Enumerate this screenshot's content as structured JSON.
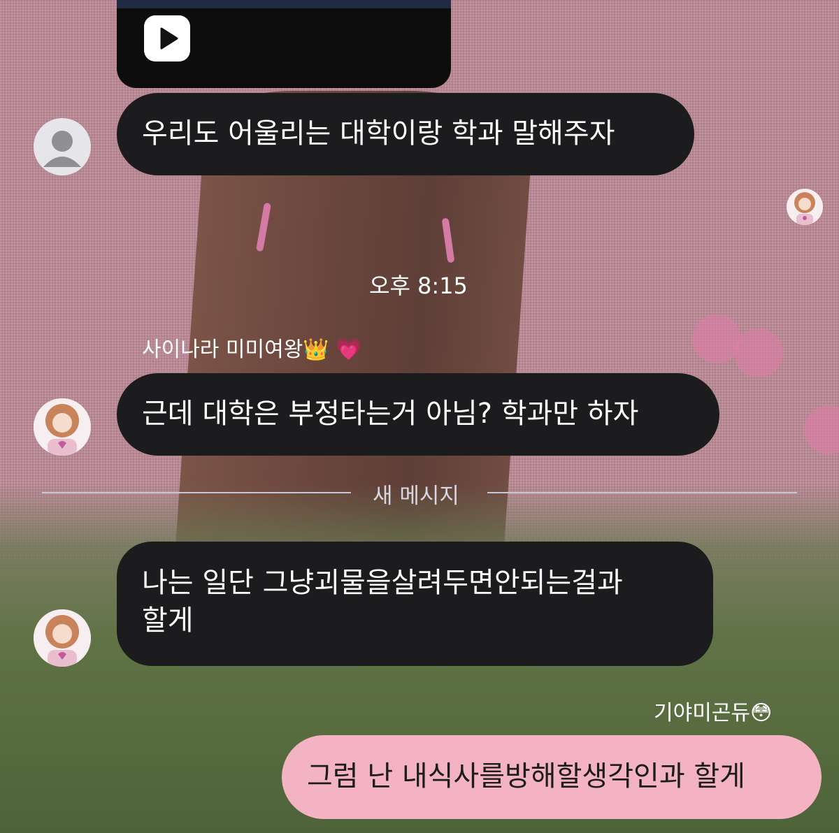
{
  "chat": {
    "timestamp": "오후 8:15",
    "new_messages_divider": "새 메시지",
    "messages": [
      {
        "sender": "",
        "text": "우리도 어울리는 대학이랑 학과 말해주자"
      },
      {
        "sender": "사이나라 미미여왕👑 💗",
        "text": "근데 대학은 부정타는거 아님? 학과만 하자"
      },
      {
        "sender": "",
        "text_line1": "나는 일단 그냥괴물을살려두면안되는걸과",
        "text_line2": "할게"
      },
      {
        "sender": "기야미곤듀😳",
        "text": "그럼 난 내식사를방해할생각인과 할게"
      }
    ]
  },
  "video": {
    "icon": "play-icon"
  },
  "colors": {
    "incoming_bubble": "#1c1c1e",
    "outgoing_bubble": "#f3b3c2",
    "background": "#b98793"
  }
}
